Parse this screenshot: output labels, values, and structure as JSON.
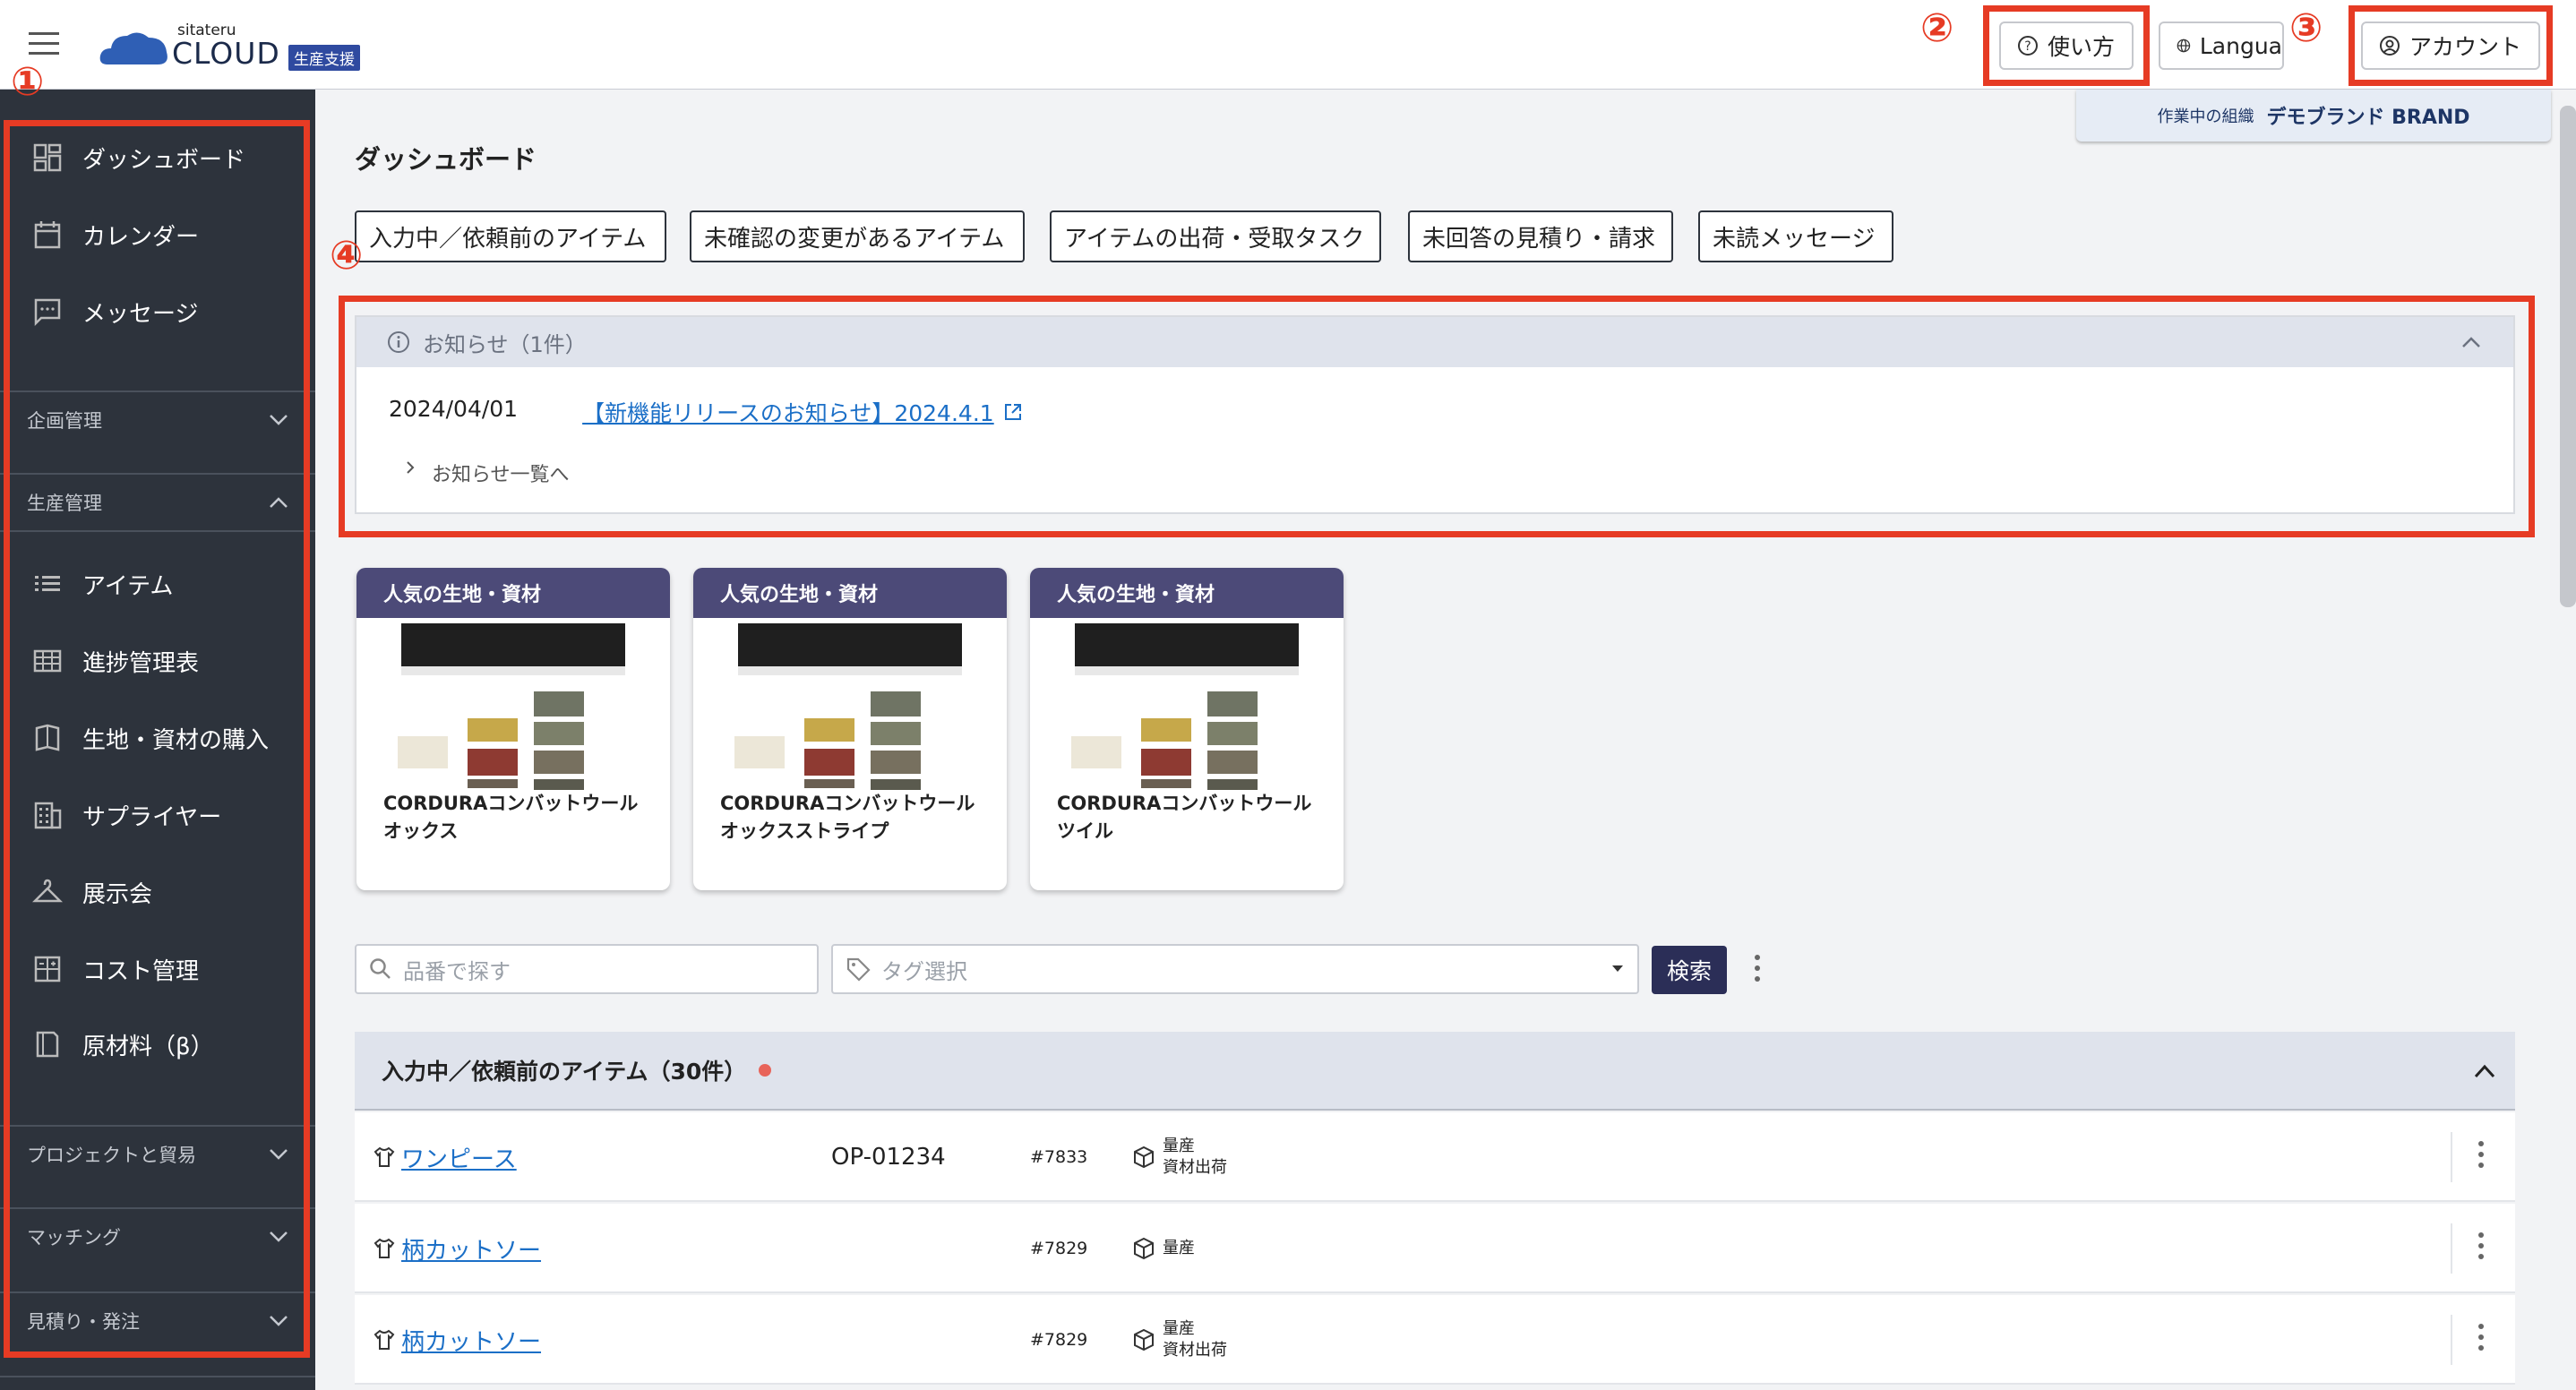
{
  "header": {
    "logo_small": "sitateru",
    "logo_main": "CLOUD",
    "logo_badge": "生産支援",
    "help_label": "使い方",
    "language_label": "Langua",
    "account_label": "アカウント",
    "org_label": "作業中の組織",
    "org_name": "デモブランド BRAND"
  },
  "annotations": [
    "①",
    "②",
    "③",
    "④"
  ],
  "sidebar": {
    "top_items": [
      {
        "label": "ダッシュボード",
        "icon": "dashboard-icon"
      },
      {
        "label": "カレンダー",
        "icon": "calendar-icon"
      },
      {
        "label": "メッセージ",
        "icon": "message-icon"
      }
    ],
    "sections": [
      {
        "label": "企画管理",
        "expanded": false
      },
      {
        "label": "生産管理",
        "expanded": true
      },
      {
        "label": "プロジェクトと貿易",
        "expanded": false
      },
      {
        "label": "マッチング",
        "expanded": false
      },
      {
        "label": "見積り・発注",
        "expanded": false
      }
    ],
    "production_items": [
      {
        "label": "アイテム",
        "icon": "list-icon"
      },
      {
        "label": "進捗管理表",
        "icon": "table-icon"
      },
      {
        "label": "生地・資材の購入",
        "icon": "book-icon"
      },
      {
        "label": "サプライヤー",
        "icon": "building-icon"
      },
      {
        "label": "展示会",
        "icon": "hanger-icon"
      },
      {
        "label": "コスト管理",
        "icon": "calculator-icon"
      },
      {
        "label": "原材料（β）",
        "icon": "material-book-icon"
      }
    ]
  },
  "main": {
    "title": "ダッシュボード",
    "filters": [
      "入力中／依頼前のアイテム",
      "未確認の変更があるアイテム",
      "アイテムの出荷・受取タスク",
      "未回答の見積り・請求",
      "未読メッセージ"
    ],
    "news": {
      "header": "お知らせ（1件）",
      "date": "2024/04/01",
      "link": "【新機能リリースのお知らせ】2024.4.1",
      "more": "お知らせ一覧へ"
    },
    "cards": [
      {
        "tag": "人気の生地・資材",
        "name_line1": "CORDURAコンバットウール",
        "name_line2": "オックス"
      },
      {
        "tag": "人気の生地・資材",
        "name_line1": "CORDURAコンバットウール",
        "name_line2": "オックスストライプ"
      },
      {
        "tag": "人気の生地・資材",
        "name_line1": "CORDURAコンバットウール",
        "name_line2": "ツイル"
      }
    ],
    "search": {
      "placeholder": "品番で探す",
      "tag_placeholder": "タグ選択",
      "button": "検索"
    },
    "list": {
      "title": "入力中／依頼前のアイテム（30件）",
      "rows": [
        {
          "name": "ワンピース",
          "code": "OP-01234",
          "number": "#7833",
          "status1": "量産",
          "status2": "資材出荷"
        },
        {
          "name": "柄カットソー",
          "code": "",
          "number": "#7829",
          "status1": "量産",
          "status2": ""
        },
        {
          "name": "柄カットソー",
          "code": "",
          "number": "#7829",
          "status1": "量産",
          "status2": "資材出荷"
        }
      ]
    }
  },
  "colors": {
    "sidebar": "#2d333c",
    "annotation": "#e63b24",
    "card_header": "#4c4a78",
    "search_button": "#2b2e57",
    "link": "#1b6fc7"
  }
}
